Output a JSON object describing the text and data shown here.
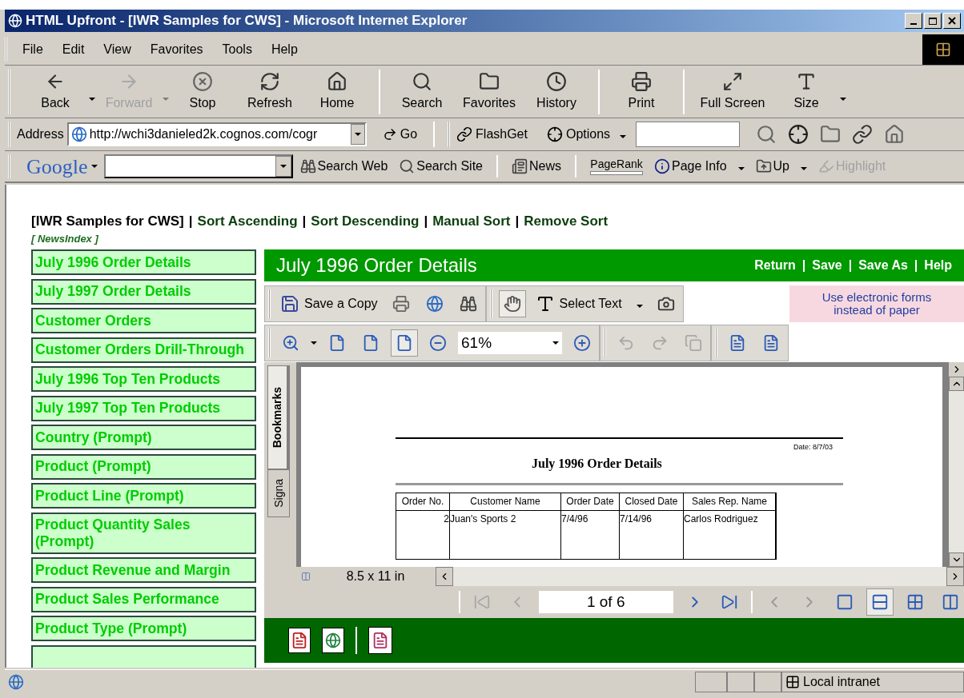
{
  "window": {
    "title": "HTML Upfront - [IWR Samples for CWS] - Microsoft Internet Explorer"
  },
  "menu": [
    "File",
    "Edit",
    "View",
    "Favorites",
    "Tools",
    "Help"
  ],
  "toolbar": [
    {
      "kind": "back",
      "label": "Back",
      "disabled": false,
      "dropdown": true
    },
    {
      "kind": "forward",
      "label": "Forward",
      "disabled": true,
      "dropdown": true
    },
    {
      "kind": "stop",
      "label": "Stop",
      "disabled": false,
      "dropdown": false
    },
    {
      "kind": "refresh",
      "label": "Refresh",
      "disabled": false,
      "dropdown": false
    },
    {
      "kind": "home",
      "label": "Home",
      "disabled": false,
      "dropdown": false
    },
    {
      "kind": "sep"
    },
    {
      "kind": "search",
      "label": "Search",
      "disabled": false,
      "dropdown": false
    },
    {
      "kind": "favorites",
      "label": "Favorites",
      "disabled": false,
      "dropdown": false
    },
    {
      "kind": "history",
      "label": "History",
      "disabled": false,
      "dropdown": false
    },
    {
      "kind": "sep"
    },
    {
      "kind": "print",
      "label": "Print",
      "disabled": false,
      "dropdown": false
    },
    {
      "kind": "sep"
    },
    {
      "kind": "fullscreen",
      "label": "Full Screen",
      "disabled": false,
      "dropdown": false
    },
    {
      "kind": "size",
      "label": "Size",
      "disabled": false,
      "dropdown": true
    }
  ],
  "address": {
    "label": "Address",
    "url": "http://wchi3danieled2k.cognos.com/cogr",
    "go": "Go"
  },
  "flashget": {
    "label": "FlashGet",
    "options": "Options"
  },
  "google": {
    "logo": "Google",
    "buttons": [
      {
        "kind": "search_web",
        "label": "Search Web",
        "disabled": false
      },
      {
        "kind": "search_site",
        "label": "Search Site",
        "disabled": false
      },
      {
        "kind": "news",
        "label": "News",
        "disabled": false
      },
      {
        "kind": "pagerank",
        "label": "PageRank",
        "disabled": false
      },
      {
        "kind": "info",
        "label": "Page Info",
        "disabled": false
      },
      {
        "kind": "up",
        "label": "Up",
        "disabled": false
      },
      {
        "kind": "highlight",
        "label": "Highlight",
        "disabled": true
      }
    ]
  },
  "page": {
    "breadcrumb": {
      "current": "[IWR Samples for CWS]",
      "separator": "|",
      "links": [
        "Sort Ascending",
        "Sort Descending",
        "Manual Sort",
        "Remove Sort"
      ]
    },
    "news_index": "[ NewsIndex ]",
    "sidebar": [
      "July 1996 Order Details",
      "July 1997 Order Details",
      "Customer Orders",
      "Customer Orders Drill-Through",
      "July 1996 Top Ten Products",
      "July 1997 Top Ten Products",
      "Country (Prompt)",
      "Product (Prompt)",
      "Product Line (Prompt)",
      "Product Quantity Sales (Prompt)",
      "Product Revenue and Margin",
      "Product Sales Performance",
      "Product Type (Prompt)"
    ]
  },
  "viewer": {
    "title": "July 1996 Order Details",
    "links": [
      "Return",
      "Save",
      "Save As",
      "Help"
    ],
    "separator": "|",
    "save_copy": "Save a Copy",
    "hand_selected": true,
    "select_text": "Select Text",
    "ad": "Use electronic forms instead of paper",
    "page_views": [
      {
        "selected": false
      },
      {
        "selected": false
      },
      {
        "selected": true
      }
    ],
    "zoom": "61%",
    "history_disabled": true,
    "tabs": [
      {
        "label": "Bookmarks",
        "selected": true
      },
      {
        "label": "Signa",
        "selected": false
      }
    ],
    "page_size": "8.5 x 11 in",
    "document": {
      "date": "Date: 8/7/03",
      "title": "July 1996 Order Details",
      "columns": [
        "Order No.",
        "Customer Name",
        "Order Date",
        "Closed Date",
        "Sales Rep. Name"
      ],
      "rows": [
        [
          "2",
          "Juan's Sports 2",
          "7/4/96",
          "7/14/96",
          "Carlos Rodriguez"
        ]
      ]
    },
    "page_nav": {
      "text": "1 of 6",
      "first_disabled": true
    },
    "layouts": [
      {
        "selected": false
      },
      {
        "selected": true
      },
      {
        "selected": false
      },
      {
        "selected": false
      }
    ]
  },
  "status_bar": {
    "zone": "Local intranet"
  }
}
